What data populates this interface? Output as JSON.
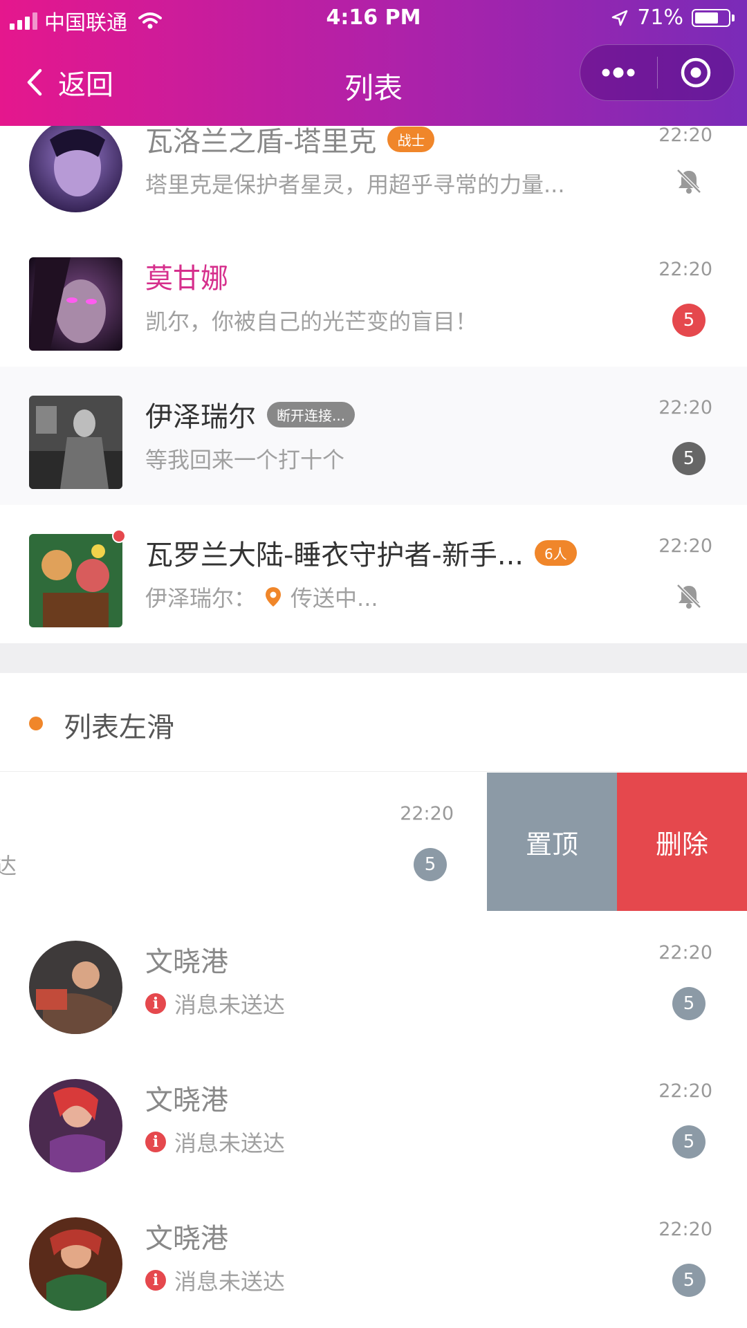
{
  "status_bar": {
    "carrier": "中国联通",
    "time": "4:16 PM",
    "battery": "71%",
    "battery_level": 0.71
  },
  "nav": {
    "back_label": "返回",
    "title": "列表"
  },
  "rows": [
    {
      "name": "瓦洛兰之盾-塔里克",
      "tag": "战士",
      "preview": "塔里克是保护者星灵，用超乎寻常的力量...",
      "time": "22:20",
      "status": "muted"
    },
    {
      "name": "莫甘娜",
      "preview": "凯尔，你被自己的光芒变的盲目！",
      "time": "22:20",
      "badge": "5"
    },
    {
      "name": "伊泽瑞尔",
      "tag": "断开连接...",
      "preview": "等我回来一个打十个",
      "time": "22:20",
      "badge": "5"
    },
    {
      "name": "瓦罗兰大陆-睡衣守护者-新手...",
      "tag": "6人",
      "preview_sender": "伊泽瑞尔：",
      "preview": "传送中...",
      "time": "22:20",
      "status": "muted"
    }
  ],
  "section": {
    "title": "列表左滑"
  },
  "swiped_row": {
    "preview_fragment": "送达",
    "time": "22:20",
    "badge": "5",
    "pin_label": "置顶",
    "delete_label": "删除"
  },
  "failed_rows": [
    {
      "name": "文晓港",
      "preview": "消息未送达",
      "time": "22:20",
      "badge": "5"
    },
    {
      "name": "文晓港",
      "preview": "消息未送达",
      "time": "22:20",
      "badge": "5"
    },
    {
      "name": "文晓港",
      "preview": "消息未送达",
      "time": "22:20",
      "badge": "5"
    }
  ],
  "colors": {
    "header_start": "#e5178d",
    "header_end": "#7a2bb8",
    "highlight_name": "#d62f8c",
    "tag_orange": "#f0862a",
    "unread_red": "#e5484d",
    "pin_gray": "#8c9aa6"
  }
}
